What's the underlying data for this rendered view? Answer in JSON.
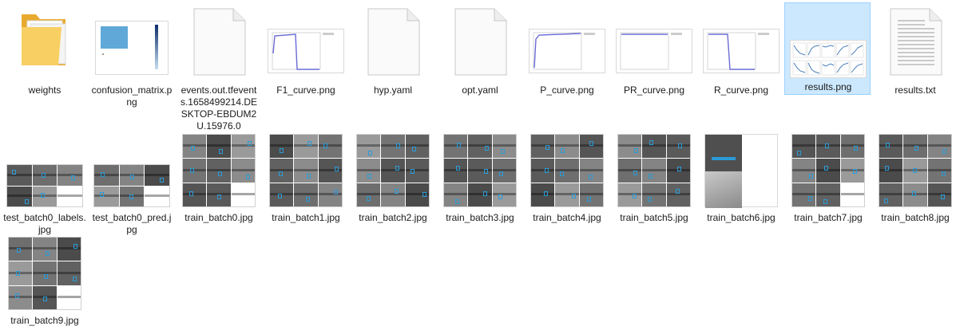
{
  "colors": {
    "selection_bg": "#cce8ff",
    "selection_border": "#99d1ff",
    "folder": "#f6c24b",
    "box": "#2a9bd8",
    "curve": "#6b6bd6"
  },
  "files": [
    {
      "name": "weights",
      "icon": "folder-icon"
    },
    {
      "name": "confusion_matrix.png",
      "icon": "confusion-matrix-thumbnail"
    },
    {
      "name": "events.out.tfevents.1658499214.DESKTOP-EBDUM2U.15976.0",
      "icon": "blank-file-icon"
    },
    {
      "name": "F1_curve.png",
      "icon": "f1-curve-thumbnail"
    },
    {
      "name": "hyp.yaml",
      "icon": "blank-file-icon"
    },
    {
      "name": "opt.yaml",
      "icon": "blank-file-icon"
    },
    {
      "name": "P_curve.png",
      "icon": "p-curve-thumbnail"
    },
    {
      "name": "PR_curve.png",
      "icon": "pr-curve-thumbnail"
    },
    {
      "name": "R_curve.png",
      "icon": "r-curve-thumbnail"
    },
    {
      "name": "results.png",
      "icon": "results-thumbnail",
      "selected": true
    },
    {
      "name": "results.txt",
      "icon": "text-file-icon"
    },
    {
      "name": "test_batch0_labels.jpg",
      "icon": "mosaic-thumbnail"
    },
    {
      "name": "test_batch0_pred.jpg",
      "icon": "mosaic-thumbnail"
    },
    {
      "name": "train_batch0.jpg",
      "icon": "mosaic-thumbnail"
    },
    {
      "name": "train_batch1.jpg",
      "icon": "mosaic-thumbnail"
    },
    {
      "name": "train_batch2.jpg",
      "icon": "mosaic-thumbnail"
    },
    {
      "name": "train_batch3.jpg",
      "icon": "mosaic-thumbnail"
    },
    {
      "name": "train_batch4.jpg",
      "icon": "mosaic-thumbnail"
    },
    {
      "name": "train_batch5.jpg",
      "icon": "mosaic-thumbnail"
    },
    {
      "name": "train_batch6.jpg",
      "icon": "mosaic-thumbnail"
    },
    {
      "name": "train_batch7.jpg",
      "icon": "mosaic-thumbnail"
    },
    {
      "name": "train_batch8.jpg",
      "icon": "mosaic-thumbnail"
    },
    {
      "name": "train_batch9.jpg",
      "icon": "mosaic-thumbnail"
    }
  ]
}
